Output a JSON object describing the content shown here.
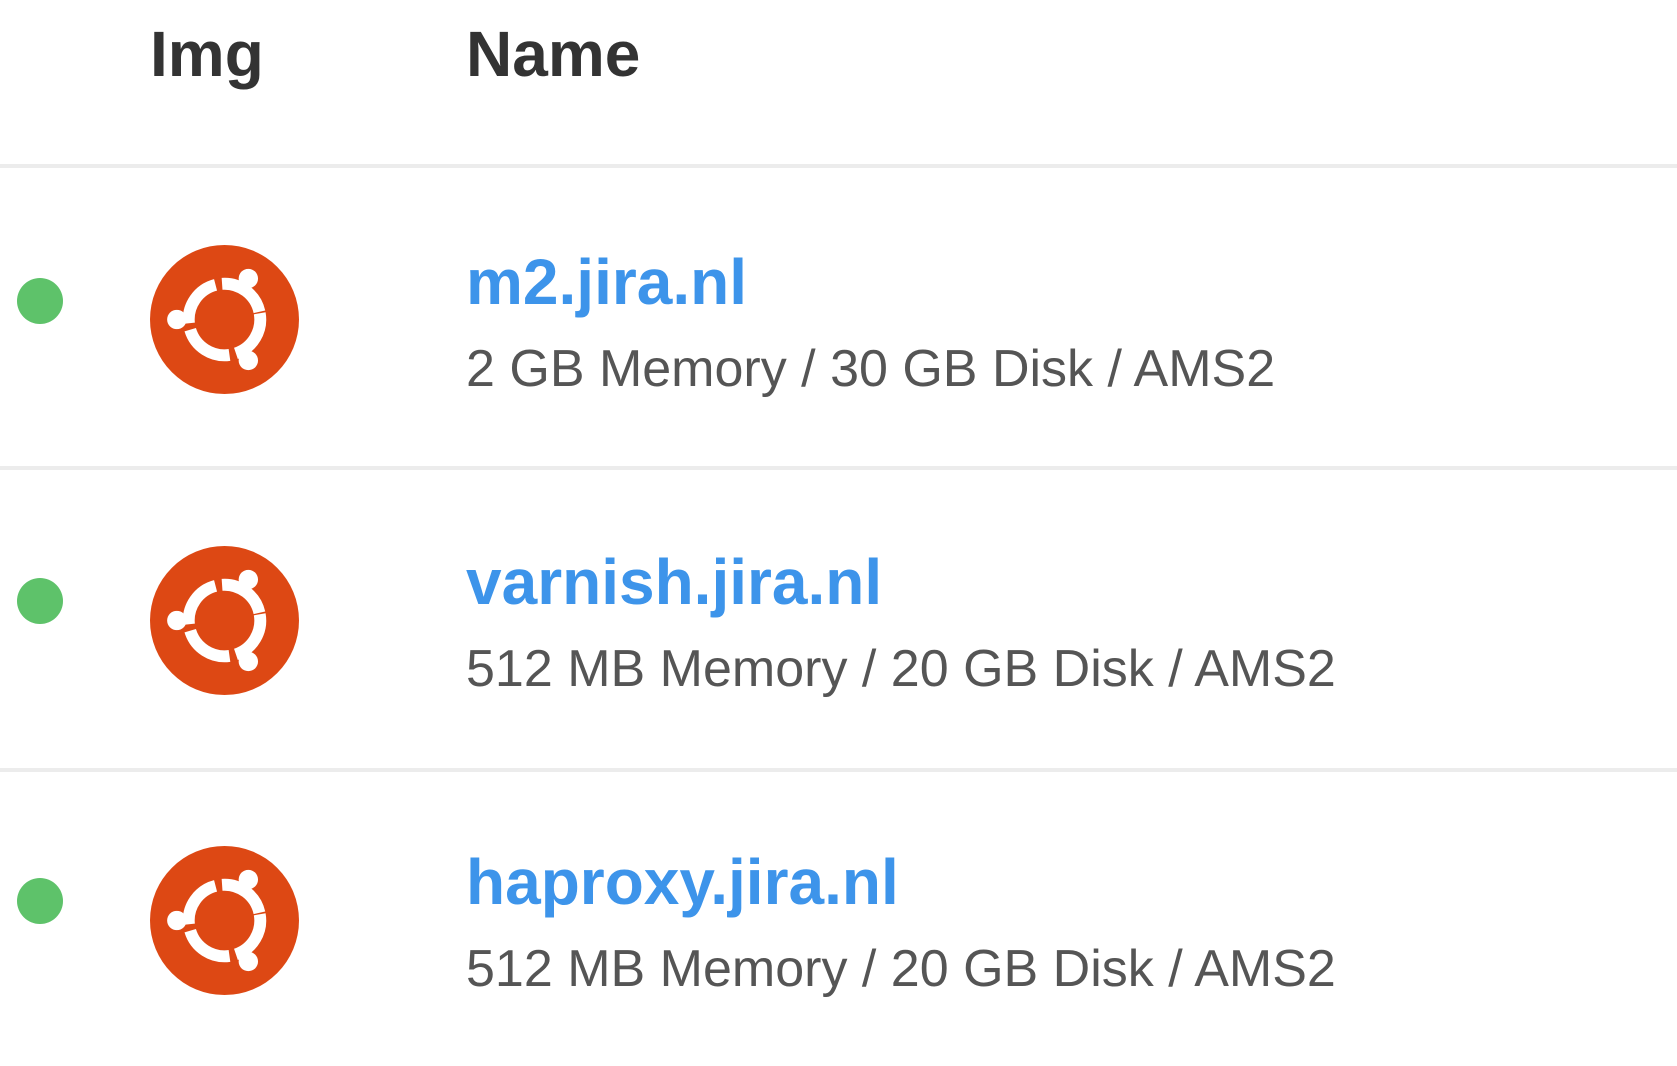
{
  "table": {
    "columns": {
      "img": "Img",
      "name": "Name"
    },
    "rows": [
      {
        "status_color": "#5ec26a",
        "os_icon": "ubuntu-icon",
        "name": "m2.jira.nl",
        "meta": "2 GB Memory / 30 GB Disk / AMS2"
      },
      {
        "status_color": "#5ec26a",
        "os_icon": "ubuntu-icon",
        "name": "varnish.jira.nl",
        "meta": "512 MB Memory / 20 GB Disk / AMS2"
      },
      {
        "status_color": "#5ec26a",
        "os_icon": "ubuntu-icon",
        "name": "haproxy.jira.nl",
        "meta": "512 MB Memory / 20 GB Disk / AMS2"
      }
    ]
  },
  "colors": {
    "link": "#3d94ea",
    "ubuntu_orange": "#dd4814",
    "status_active": "#5ec26a"
  }
}
